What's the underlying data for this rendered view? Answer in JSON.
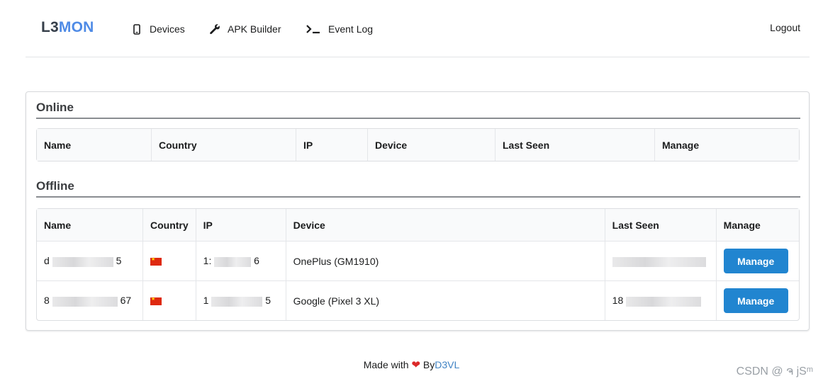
{
  "brand": {
    "prefix": "L3",
    "suffix": "MON"
  },
  "nav": [
    {
      "label": "Devices",
      "icon": "mobile-icon"
    },
    {
      "label": "APK Builder",
      "icon": "wrench-icon"
    },
    {
      "label": "Event Log",
      "icon": "terminal-icon"
    }
  ],
  "logout_label": "Logout",
  "online": {
    "title": "Online",
    "columns": [
      "Name",
      "Country",
      "IP",
      "Device",
      "Last Seen",
      "Manage"
    ]
  },
  "offline": {
    "title": "Offline",
    "columns": [
      "Name",
      "Country",
      "IP",
      "Device",
      "Last Seen",
      "Manage"
    ],
    "rows": [
      {
        "name_start": "d",
        "name_end": "5",
        "ip_start": "1:",
        "ip_end": "6",
        "device": "OnePlus (GM1910)",
        "last_seen_start": "",
        "manage_label": "Manage"
      },
      {
        "name_start": "8",
        "name_end": "67",
        "ip_start": "1",
        "ip_end": "5",
        "device": "Google (Pixel 3 XL)",
        "last_seen_start": "18",
        "manage_label": "Manage"
      }
    ]
  },
  "footer": {
    "made_with": "Made with",
    "by": "By",
    "author": "D3VL"
  },
  "watermark": "CSDN @ ຈ jSᵐ",
  "colors": {
    "accent": "#2185d0",
    "brand": "#4f8be6",
    "heart": "#db2828"
  }
}
